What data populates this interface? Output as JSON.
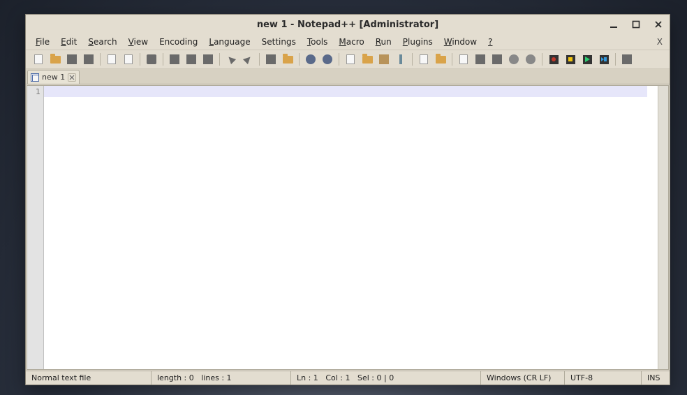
{
  "titlebar": {
    "title": "new 1 - Notepad++ [Administrator]"
  },
  "menubar": {
    "items": [
      {
        "label": "File",
        "ul": "F"
      },
      {
        "label": "Edit",
        "ul": "E"
      },
      {
        "label": "Search",
        "ul": "S"
      },
      {
        "label": "View",
        "ul": "V"
      },
      {
        "label": "Encoding",
        "ul": ""
      },
      {
        "label": "Language",
        "ul": "L"
      },
      {
        "label": "Settings",
        "ul": ""
      },
      {
        "label": "Tools",
        "ul": "T"
      },
      {
        "label": "Macro",
        "ul": "M"
      },
      {
        "label": "Run",
        "ul": "R"
      },
      {
        "label": "Plugins",
        "ul": "P"
      },
      {
        "label": "Window",
        "ul": "W"
      },
      {
        "label": "?",
        "ul": "?"
      }
    ],
    "close_x": "X"
  },
  "toolbar": {
    "icons": [
      "new-file",
      "open-file",
      "save",
      "save-all",
      "|",
      "close",
      "close-all",
      "|",
      "print",
      "|",
      "cut",
      "copy",
      "paste",
      "|",
      "undo",
      "redo",
      "|",
      "find",
      "replace",
      "|",
      "zoom-in",
      "zoom-out",
      "|",
      "sync-v",
      "sync-h",
      "|",
      "word-wrap",
      "all-chars",
      "|",
      "indent-guide",
      "fold-all",
      "unfold-all",
      "|",
      "doc-map",
      "doc-list",
      "function-list",
      "|",
      "folder-as-workspace",
      "monitoring",
      "|",
      "macro-record",
      "macro-stop",
      "macro-play",
      "macro-run-multi",
      "|",
      "spacer"
    ]
  },
  "tabs": {
    "items": [
      {
        "label": "new 1"
      }
    ]
  },
  "editor": {
    "line_number": "1",
    "content": ""
  },
  "statusbar": {
    "file_type": "Normal text file",
    "length_label": "length : 0",
    "lines_label": "lines : 1",
    "ln_label": "Ln : 1",
    "col_label": "Col : 1",
    "sel_label": "Sel : 0 | 0",
    "eol": "Windows (CR LF)",
    "encoding": "UTF-8",
    "ins": "INS"
  }
}
